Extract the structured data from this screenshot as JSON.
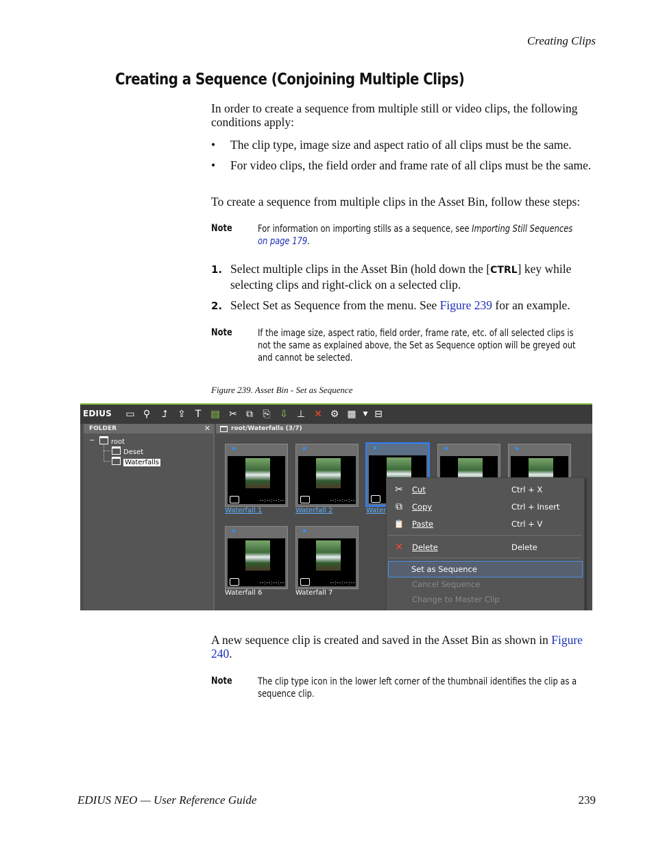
{
  "header": {
    "running_title": "Creating Clips"
  },
  "section": {
    "title": "Creating a Sequence (Conjoining Multiple Clips)"
  },
  "body": {
    "intro": "In order to create a sequence from multiple still or video clips, the following conditions apply:",
    "bullets": [
      "The clip type, image size and aspect ratio of all clips must be the same.",
      "For video clips, the field order and frame rate of all clips must be the same."
    ],
    "steps_intro": "To create a sequence from multiple clips in the Asset Bin, follow these steps:",
    "note1": {
      "label": "Note",
      "text_a": "For information on importing stills as a sequence, see ",
      "text_link_title": "Importing Still Sequences",
      "text_link_page": " on page 179",
      "text_end": "."
    },
    "steps": [
      {
        "num": "1.",
        "text_a": "Select multiple clips in the Asset Bin (hold down the [",
        "key": "CTRL",
        "text_b": "] key while selecting clips and right-click on a selected clip."
      },
      {
        "num": "2.",
        "text_a": "Select Set as Sequence from the menu. See ",
        "link": "Figure 239",
        "text_b": " for an example."
      }
    ],
    "note2": {
      "label": "Note",
      "text": "If the image size, aspect ratio, field order, frame rate, etc. of all selected clips is not the same as explained above, the Set as Sequence option will be greyed out and cannot be selected."
    },
    "figure_caption": "Figure 239.  Asset Bin - Set as Sequence",
    "after_text_a": "A new sequence clip is created and saved in the Asset Bin as shown in ",
    "after_link": "Figure 240",
    "after_text_b": ".",
    "note3": {
      "label": "Note",
      "text": "The clip type icon in the lower left corner of the thumbnail identifies the clip as a sequence clip."
    }
  },
  "screenshot": {
    "app_logo": "EDIUS",
    "accent_color": "#8fbf4a",
    "folder_panel": {
      "title": "FOLDER",
      "close": "✕",
      "tree": [
        {
          "label": "root",
          "expander": "−"
        },
        {
          "label": "Deset"
        },
        {
          "label": "Waterfalls",
          "selected": true
        }
      ]
    },
    "bin": {
      "path": "root/Waterfalls (3/7)",
      "clips": [
        {
          "label": "Waterfall 1",
          "timecode": "--:--:--:--"
        },
        {
          "label": "Waterfall 2",
          "timecode": "--:--:--:--"
        },
        {
          "label": "Water",
          "timecode": ""
        },
        {
          "label": "Waterfall 6",
          "timecode": "--:--:--:--"
        },
        {
          "label": "Waterfall 7",
          "timecode": "--:--:--:--"
        }
      ]
    },
    "context_menu": {
      "items": [
        {
          "icon": "scissors-icon",
          "glyph": "✂",
          "label": "Cut",
          "shortcut": "Ctrl + X"
        },
        {
          "icon": "copy-icon",
          "glyph": "⧉",
          "label": "Copy",
          "shortcut": "Ctrl + Insert"
        },
        {
          "icon": "paste-icon",
          "glyph": "📋",
          "label": "Paste",
          "shortcut": "Ctrl + V"
        },
        {
          "icon": "delete-icon",
          "glyph": "✕",
          "label": "Delete",
          "shortcut": "Delete"
        },
        {
          "label": "Set as Sequence",
          "highlighted": true
        },
        {
          "label": "Cancel Sequence",
          "disabled": true
        },
        {
          "label": "Change to Master Clip",
          "disabled": true
        }
      ]
    }
  },
  "footer": {
    "left": "EDIUS NEO  —  User Reference Guide",
    "page": "239"
  }
}
